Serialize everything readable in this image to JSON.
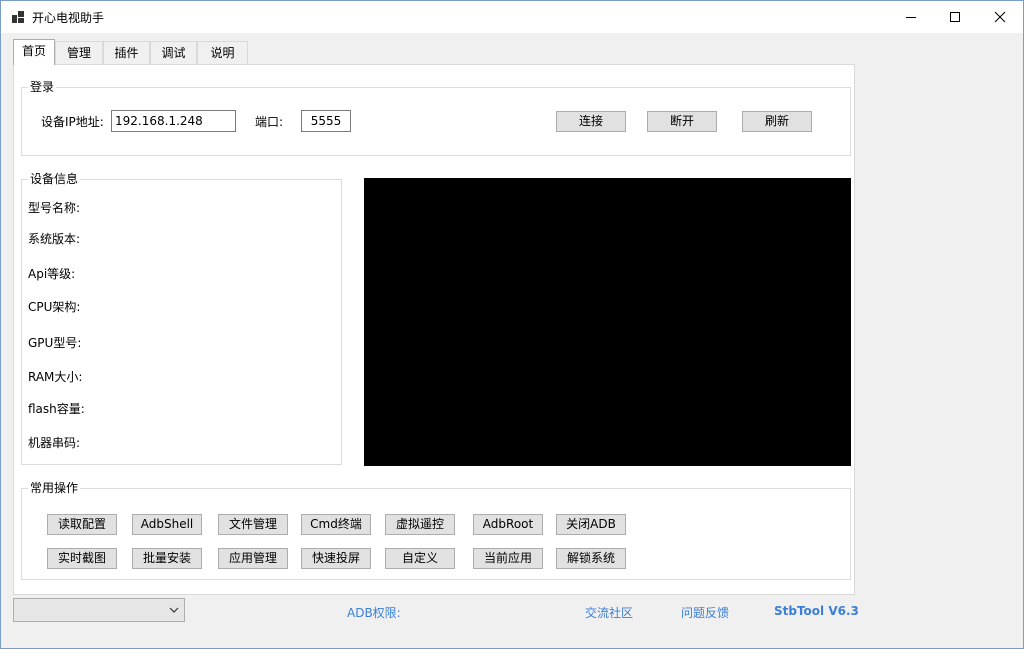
{
  "window": {
    "title": "开心电视助手"
  },
  "tabs": [
    {
      "label": "首页",
      "active": true
    },
    {
      "label": "管理"
    },
    {
      "label": "插件"
    },
    {
      "label": "调试"
    },
    {
      "label": "说明"
    }
  ],
  "login": {
    "legend": "登录",
    "ip_label": "设备IP地址:",
    "ip_value": "192.168.1.248",
    "port_label": "端口:",
    "port_value": "5555",
    "connect": "连接",
    "disconnect": "断开",
    "refresh": "刷新"
  },
  "device": {
    "legend": "设备信息",
    "model": "型号名称:",
    "system": "系统版本:",
    "api": "Api等级:",
    "cpu": "CPU架构:",
    "gpu": "GPU型号:",
    "ram": "RAM大小:",
    "flash": "flash容量:",
    "serial": "机器串码:"
  },
  "ops": {
    "legend": "常用操作",
    "row1": [
      "读取配置",
      "AdbShell",
      "文件管理",
      "Cmd终端",
      "虚拟遥控",
      "AdbRoot",
      "关闭ADB"
    ],
    "row2": [
      "实时截图",
      "批量安装",
      "应用管理",
      "快速投屏",
      "自定义",
      "当前应用",
      "解锁系统"
    ]
  },
  "footer": {
    "combo_value": "",
    "adb_permission": "ADB权限:",
    "community": "交流社区",
    "feedback": "问题反馈",
    "version": "StbTool V6.3"
  },
  "colors": {
    "link": "#3a7fd5",
    "screen": "#000000"
  },
  "icons": {
    "app": "app-icon",
    "minimize": "minimize-icon",
    "maximize": "maximize-icon",
    "close": "close-icon",
    "combo": "chevron-down-icon"
  }
}
